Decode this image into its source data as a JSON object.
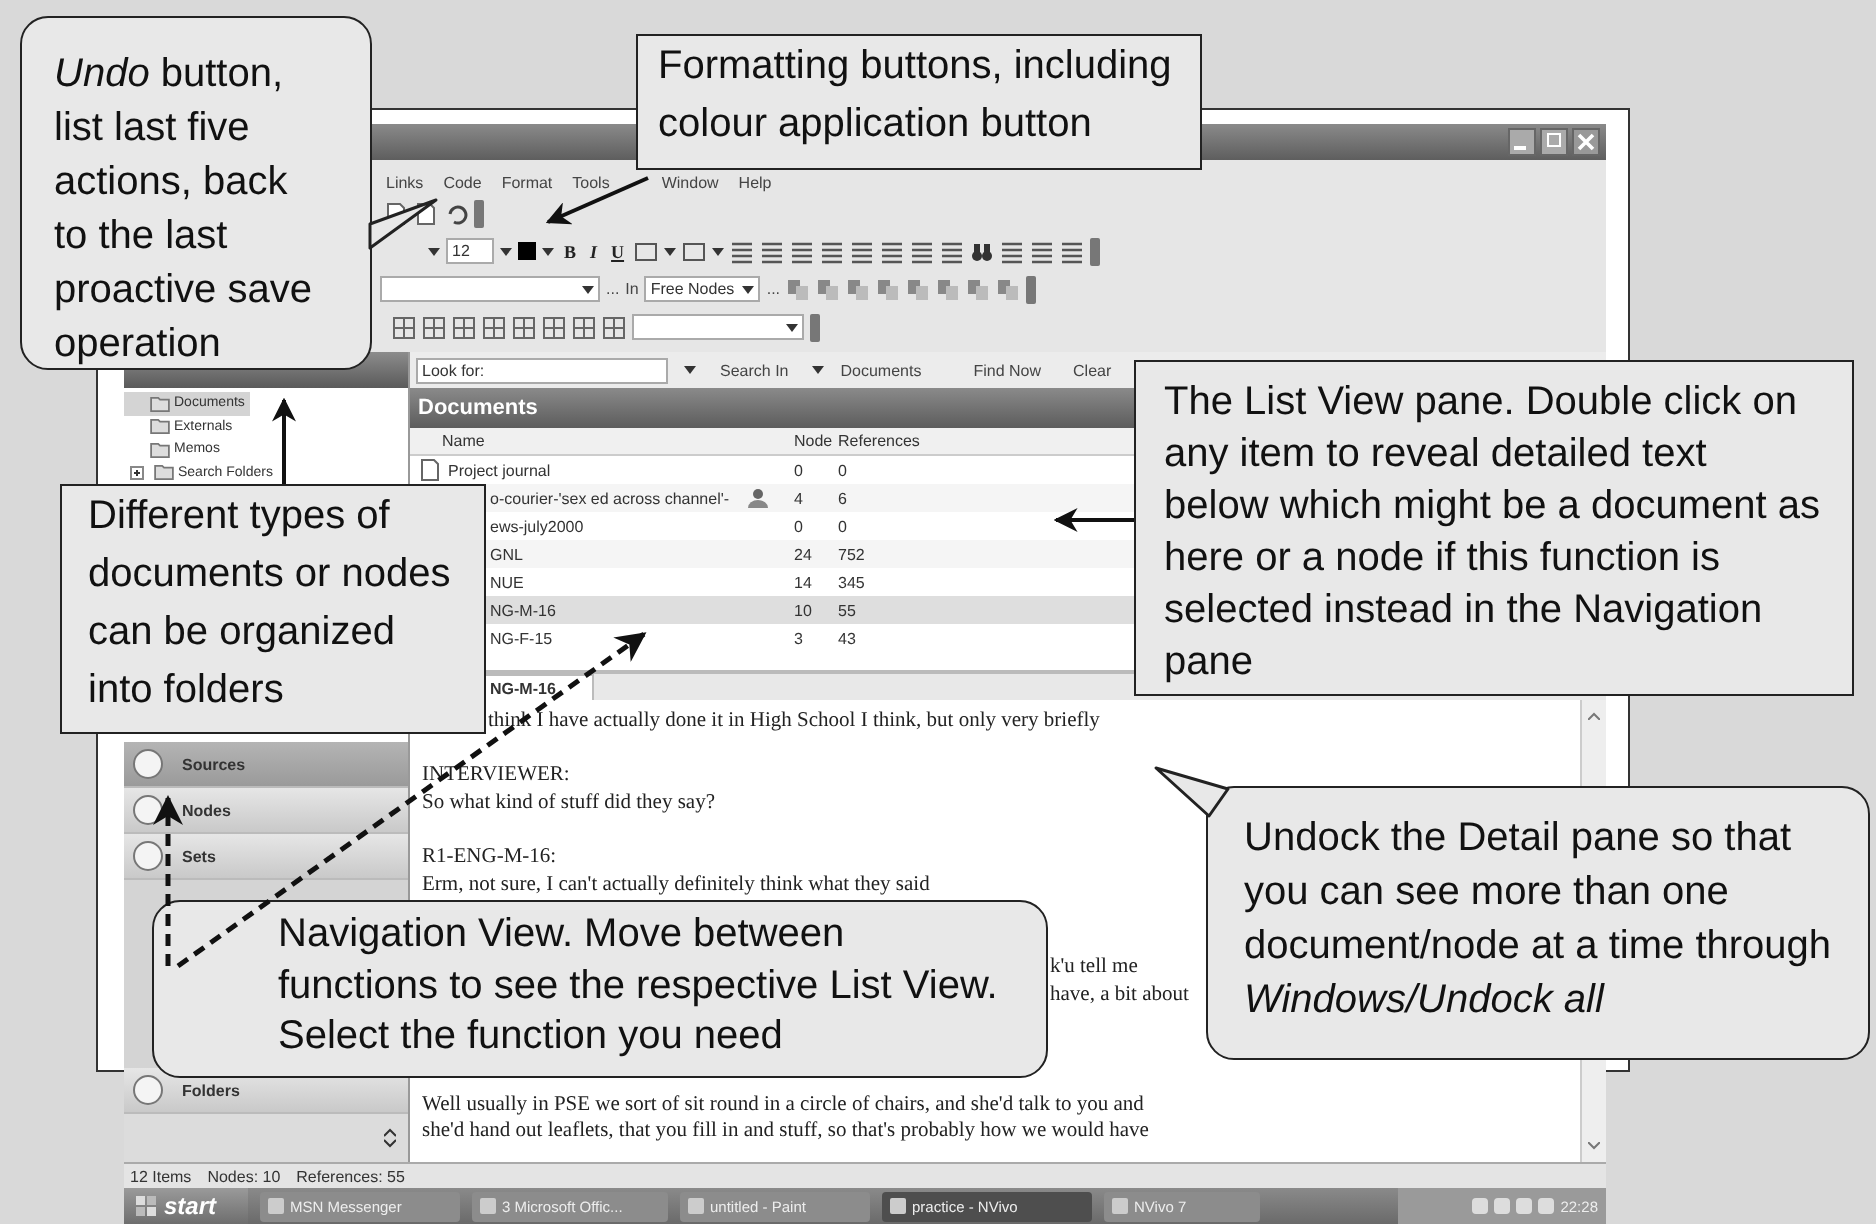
{
  "menu": [
    "Links",
    "Code",
    "Format",
    "Tools",
    "Window",
    "Help"
  ],
  "toolbar": {
    "font_size": "12",
    "format_buttons": [
      "B",
      "I",
      "U"
    ],
    "browse_1": "...",
    "code_in": "In",
    "code_target": "Free Nodes",
    "browse_2": "..."
  },
  "find_bar": {
    "label": "Look for:",
    "search_in": "Search In",
    "scope": "Documents",
    "find": "Find Now",
    "clear": "Clear"
  },
  "tree": [
    {
      "label": "Documents",
      "selected": true,
      "collapsed": false
    },
    {
      "label": "Externals",
      "selected": false,
      "collapsed": false
    },
    {
      "label": "Memos",
      "selected": false,
      "collapsed": false
    },
    {
      "label": "Search Folders",
      "selected": false,
      "collapsed": true
    }
  ],
  "navigation": {
    "top": [
      {
        "label": "Sources",
        "selected": true
      },
      {
        "label": "Nodes",
        "selected": false
      },
      {
        "label": "Sets",
        "selected": false
      }
    ],
    "bottom": [
      {
        "label": "Folders",
        "selected": false
      }
    ]
  },
  "list": {
    "title": "Documents",
    "columns": [
      "Name",
      "Node",
      "References"
    ],
    "rows": [
      {
        "kind": "document",
        "name": "Project journal",
        "node": "0",
        "references": "0",
        "selected": false,
        "shared": false
      },
      {
        "kind": "covered",
        "name": "o-courier-'sex ed across channel'-",
        "node": "4",
        "references": "6",
        "selected": false,
        "shared": true
      },
      {
        "kind": "covered",
        "name": "ews-july2000",
        "node": "0",
        "references": "0",
        "selected": false,
        "shared": false
      },
      {
        "kind": "covered",
        "name": "GNL",
        "node": "24",
        "references": "752",
        "selected": false,
        "shared": false
      },
      {
        "kind": "covered",
        "name": "NUE",
        "node": "14",
        "references": "345",
        "selected": false,
        "shared": false
      },
      {
        "kind": "covered",
        "name": "NG-M-16",
        "node": "10",
        "references": "55",
        "selected": true,
        "shared": false
      },
      {
        "kind": "covered",
        "name": "NG-F-15",
        "node": "3",
        "references": "43",
        "selected": false,
        "shared": false
      }
    ]
  },
  "detail": {
    "tab": "NG-M-16",
    "lines": [
      {
        "kind": "head",
        "text": "think I have actually done it in High School I think, but only very briefly"
      },
      {
        "kind": "blank"
      },
      {
        "kind": "line",
        "text": "INTERVIEWER:"
      },
      {
        "kind": "line",
        "text": "So what kind of stuff did they say?"
      },
      {
        "kind": "blank"
      },
      {
        "kind": "line",
        "text": "R1-ENG-M-16:"
      },
      {
        "kind": "line",
        "text": "Erm, not sure, I can't actually definitely think what they said"
      },
      {
        "kind": "blank"
      },
      {
        "kind": "blank"
      },
      {
        "kind": "tail",
        "text": "k'u tell me"
      },
      {
        "kind": "tail",
        "text": "have, a bit about"
      },
      {
        "kind": "blank"
      },
      {
        "kind": "blank"
      },
      {
        "kind": "blank"
      },
      {
        "kind": "line",
        "text": "Well usually in PSE we sort of sit round in a circle of chairs, and she'd talk to you and"
      },
      {
        "kind": "line",
        "text": "she'd hand out leaflets, that you fill in and stuff, so that's probably how we would have"
      }
    ]
  },
  "status_bar": [
    "12 Items",
    "Nodes: 10",
    "References: 55"
  ],
  "taskbar": {
    "start": "start",
    "tasks": [
      {
        "label": "MSN Messenger",
        "selected": false
      },
      {
        "label": "3 Microsoft Offic...",
        "selected": false
      },
      {
        "label": "untitled - Paint",
        "selected": false
      },
      {
        "label": "practice - NVivo",
        "selected": true
      },
      {
        "label": "NVivo 7",
        "selected": false
      }
    ],
    "clock": "22:28"
  },
  "callouts": [
    {
      "kind": "speech",
      "text": "*Undo* button, list last five actions, back to the last proactive save operation"
    },
    {
      "kind": "box",
      "text": "Formatting buttons, including colour application button"
    },
    {
      "kind": "box",
      "text": "The List View pane. Double click on any item to reveal detailed text below which might be a document as here or a node if this function is selected instead in the Navigation pane"
    },
    {
      "kind": "box",
      "text": "Different types of documents or nodes can be organized into folders"
    },
    {
      "kind": "speech",
      "text": "Undock the Detail pane so that you can see more than one document/node at a time through *Windows/Undock all*"
    },
    {
      "kind": "rounded",
      "text": "Navigation View. Move between functions to see the respective List View. Select the function you need"
    }
  ]
}
